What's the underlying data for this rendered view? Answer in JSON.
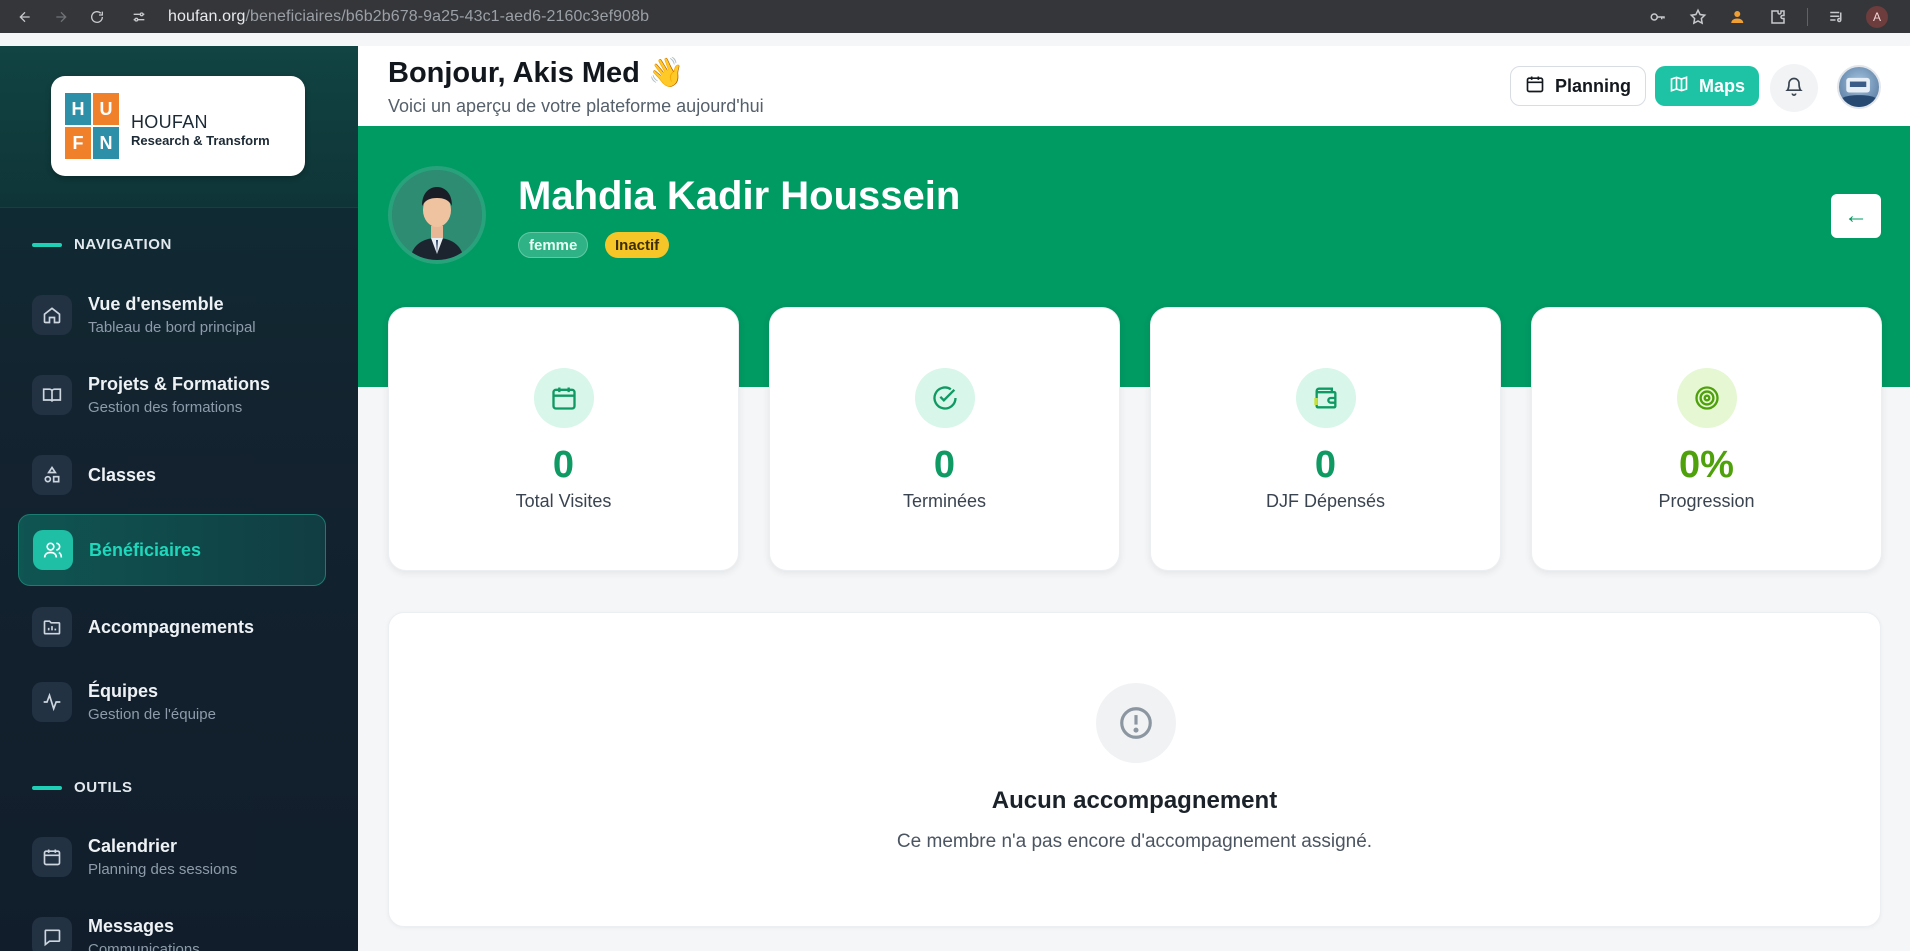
{
  "browser": {
    "url_host": "houfan.org",
    "url_path": "/beneficiaires/b6b2b678-9a25-43c1-aed6-2160c3ef908b",
    "profile_initial": "A"
  },
  "logo": {
    "letters": [
      "H",
      "U",
      "F",
      "N"
    ],
    "name": "HOUFAN",
    "tagline": "Research & Transform"
  },
  "sidebar": {
    "navigation_label": "NAVIGATION",
    "tools_label": "OUTILS",
    "items": [
      {
        "label": "Vue d'ensemble",
        "sub": "Tableau de bord principal",
        "icon": "home-icon"
      },
      {
        "label": "Projets & Formations",
        "sub": "Gestion des formations",
        "icon": "book-icon"
      },
      {
        "label": "Classes",
        "sub": "",
        "icon": "shapes-icon"
      },
      {
        "label": "Bénéficiaires",
        "sub": "",
        "icon": "users-icon",
        "active": true
      },
      {
        "label": "Accompagnements",
        "sub": "",
        "icon": "folder-chart-icon"
      },
      {
        "label": "Équipes",
        "sub": "Gestion de l'équipe",
        "icon": "activity-icon"
      }
    ],
    "tools": [
      {
        "label": "Calendrier",
        "sub": "Planning des sessions",
        "icon": "calendar-icon"
      },
      {
        "label": "Messages",
        "sub": "Communications",
        "icon": "message-icon"
      }
    ]
  },
  "header": {
    "greeting": "Bonjour, Akis Med 👋",
    "subtitle": "Voici un aperçu de votre plateforme aujourd'hui",
    "planning_label": "Planning",
    "maps_label": "Maps"
  },
  "profile": {
    "name": "Mahdia Kadir Houssein",
    "gender": "femme",
    "status": "Inactif",
    "back_label": "←"
  },
  "stats": [
    {
      "value": "0",
      "label": "Total Visites",
      "icon": "calendar-icon",
      "color": "#0f9a63",
      "bg": "#d8f6ea"
    },
    {
      "value": "0",
      "label": "Terminées",
      "icon": "check-circle-icon",
      "color": "#0f9a63",
      "bg": "#d8f6ea"
    },
    {
      "value": "0",
      "label": "DJF Dépensés",
      "icon": "wallet-icon",
      "color": "#0f9a63",
      "bg": "#d8f6ea"
    },
    {
      "value": "0%",
      "label": "Progression",
      "icon": "target-icon",
      "color": "#4fa10c",
      "bg": "#e6f7d3"
    }
  ],
  "empty_state": {
    "title": "Aucun accompagnement",
    "message": "Ce membre n'a pas encore d'accompagnement assigné."
  },
  "colors": {
    "brand_green": "#009a63",
    "accent_teal": "#1ec2a4",
    "badge_yellow": "#f6c628"
  }
}
